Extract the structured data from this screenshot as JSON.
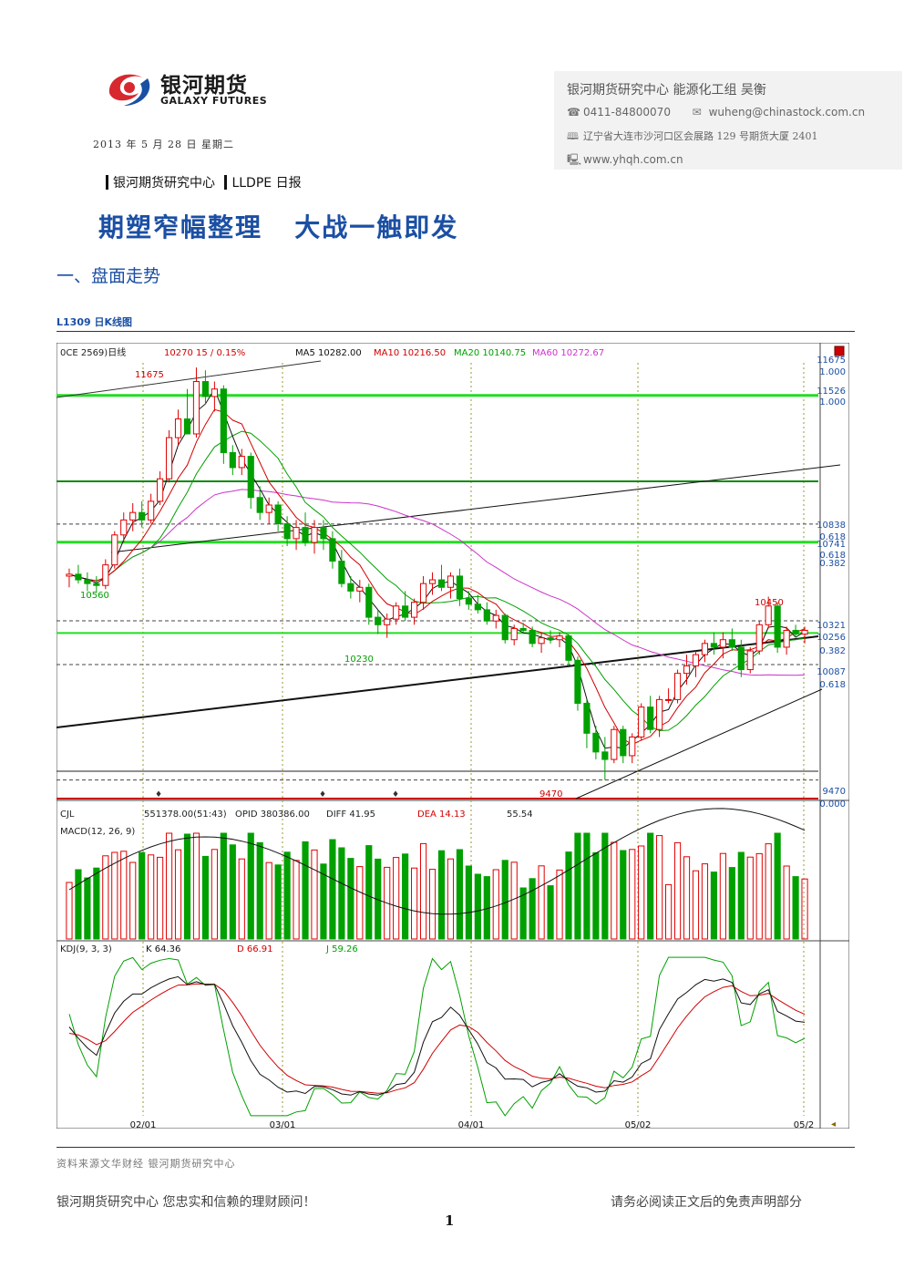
{
  "header": {
    "logo_cn": "银河期货",
    "logo_en": "GALAXY FUTURES",
    "date": "2013 年 5 月 28 日   星期二"
  },
  "contact": {
    "org": "银河期货研究中心    能源化工组 吴衡",
    "phone_icon": "☎",
    "phone": "0411-84800070",
    "mail_icon": "✉",
    "email": "wuheng@chinastock.com.cn",
    "addr_icon": "🕮",
    "address": "辽宁省大连市沙河口区会展路 129 号期货大厦 2401",
    "web_icon": "🖳",
    "website": "www.yhqh.com.cn"
  },
  "breadcrumb": {
    "part1": "银河期货研究中心",
    "part2": "LLDPE 日报"
  },
  "title": "期塑窄幅整理   大战一触即发",
  "section1": "一、盘面走势",
  "chart_caption": "L1309 日K线图",
  "chart_data": [
    {
      "type": "candlestick",
      "title": "L1309 日K线",
      "legend": {
        "code": "0CE 2569)日线",
        "price": "10270  15 / 0.15%",
        "ma5": "MA5 10282.00",
        "ma10": "MA10 10216.50",
        "ma20": "MA20 10140.75",
        "ma60": "MA60 10272.67"
      },
      "right_axis_labels": [
        "11675",
        "1.000",
        "11526",
        "1.000",
        "10838",
        "0.618",
        "10741",
        "0.618",
        "0.382",
        "10321",
        "10256",
        "0.382",
        "10087",
        "0.618",
        "9470",
        "0.000"
      ],
      "annotations": [
        "11675",
        "10560",
        "10230",
        "10450",
        "9470"
      ],
      "x_labels": [
        "02/01",
        "03/01",
        "04/01",
        "05/02",
        "05/2"
      ],
      "ylim": [
        9400,
        11700
      ],
      "horizontal_levels": [
        11526,
        10838,
        10741,
        10321,
        10256,
        10087,
        9470
      ],
      "candles": [
        [
          10560,
          10600,
          10500,
          10570
        ],
        [
          10570,
          10620,
          10520,
          10540
        ],
        [
          10540,
          10580,
          10480,
          10520
        ],
        [
          10520,
          10560,
          10470,
          10510
        ],
        [
          10510,
          10650,
          10490,
          10620
        ],
        [
          10620,
          10800,
          10600,
          10780
        ],
        [
          10780,
          10900,
          10740,
          10860
        ],
        [
          10860,
          10950,
          10800,
          10900
        ],
        [
          10900,
          10960,
          10820,
          10860
        ],
        [
          10860,
          11000,
          10840,
          10960
        ],
        [
          10960,
          11120,
          10940,
          11080
        ],
        [
          11080,
          11340,
          11060,
          11300
        ],
        [
          11300,
          11450,
          11260,
          11400
        ],
        [
          11400,
          11560,
          11360,
          11320
        ],
        [
          11320,
          11675,
          11300,
          11600
        ],
        [
          11600,
          11660,
          11480,
          11520
        ],
        [
          11520,
          11600,
          11440,
          11560
        ],
        [
          11560,
          11580,
          11160,
          11220
        ],
        [
          11220,
          11260,
          11100,
          11140
        ],
        [
          11140,
          11240,
          11100,
          11200
        ],
        [
          11200,
          11220,
          10920,
          10980
        ],
        [
          10980,
          11040,
          10860,
          10900
        ],
        [
          10900,
          10980,
          10840,
          10940
        ],
        [
          10940,
          10960,
          10800,
          10840
        ],
        [
          10840,
          10880,
          10720,
          10760
        ],
        [
          10760,
          10860,
          10700,
          10820
        ],
        [
          10820,
          10900,
          10720,
          10740
        ],
        [
          10740,
          10860,
          10680,
          10820
        ],
        [
          10820,
          10860,
          10700,
          10760
        ],
        [
          10760,
          10800,
          10600,
          10640
        ],
        [
          10640,
          10700,
          10500,
          10520
        ],
        [
          10520,
          10560,
          10440,
          10480
        ],
        [
          10480,
          10540,
          10420,
          10500
        ],
        [
          10500,
          10520,
          10300,
          10340
        ],
        [
          10340,
          10380,
          10250,
          10300
        ],
        [
          10300,
          10360,
          10230,
          10330
        ],
        [
          10330,
          10420,
          10300,
          10400
        ],
        [
          10400,
          10480,
          10320,
          10340
        ],
        [
          10340,
          10440,
          10300,
          10420
        ],
        [
          10420,
          10560,
          10380,
          10520
        ],
        [
          10520,
          10580,
          10460,
          10540
        ],
        [
          10540,
          10620,
          10480,
          10500
        ],
        [
          10500,
          10580,
          10440,
          10560
        ],
        [
          10560,
          10600,
          10400,
          10440
        ],
        [
          10440,
          10480,
          10380,
          10410
        ],
        [
          10410,
          10460,
          10360,
          10380
        ],
        [
          10380,
          10420,
          10300,
          10320
        ],
        [
          10320,
          10380,
          10280,
          10350
        ],
        [
          10350,
          10360,
          10200,
          10220
        ],
        [
          10220,
          10300,
          10190,
          10280
        ],
        [
          10280,
          10310,
          10260,
          10270
        ],
        [
          10270,
          10290,
          10180,
          10200
        ],
        [
          10200,
          10260,
          10150,
          10230
        ],
        [
          10230,
          10270,
          10200,
          10220
        ],
        [
          10220,
          10260,
          10180,
          10240
        ],
        [
          10240,
          10250,
          10080,
          10110
        ],
        [
          10110,
          10130,
          9840,
          9880
        ],
        [
          9880,
          9900,
          9640,
          9720
        ],
        [
          9720,
          9760,
          9580,
          9620
        ],
        [
          9620,
          9700,
          9470,
          9580
        ],
        [
          9580,
          9760,
          9560,
          9740
        ],
        [
          9740,
          9760,
          9560,
          9600
        ],
        [
          9600,
          9720,
          9560,
          9700
        ],
        [
          9700,
          9880,
          9680,
          9860
        ],
        [
          9860,
          9920,
          9720,
          9740
        ],
        [
          9740,
          9920,
          9700,
          9900
        ],
        [
          9900,
          9960,
          9880,
          9900
        ],
        [
          9900,
          10060,
          9880,
          10040
        ],
        [
          10040,
          10140,
          9980,
          10080
        ],
        [
          10080,
          10160,
          10020,
          10140
        ],
        [
          10140,
          10220,
          10100,
          10200
        ],
        [
          10200,
          10260,
          10140,
          10180
        ],
        [
          10180,
          10260,
          10120,
          10220
        ],
        [
          10220,
          10280,
          10160,
          10180
        ],
        [
          10180,
          10220,
          10020,
          10060
        ],
        [
          10060,
          10180,
          10040,
          10160
        ],
        [
          10160,
          10320,
          10140,
          10300
        ],
        [
          10300,
          10450,
          10280,
          10400
        ],
        [
          10400,
          10420,
          10150,
          10180
        ],
        [
          10180,
          10290,
          10140,
          10270
        ],
        [
          10270,
          10300,
          10230,
          10250
        ],
        [
          10250,
          10290,
          10200,
          10270
        ]
      ],
      "cjl_label": "CJL",
      "cjl_values": "551378.00(51:43)",
      "opid": "OPID  380386.00",
      "macd_label": "MACD(12, 26, 9)",
      "diff": "DIFF  41.95",
      "dea": "DEA  14.13",
      "macd": "55.54",
      "kdj_label": "KDJ(9, 3, 3)",
      "kdj_k": "K  64.36",
      "kdj_d": "D  66.91",
      "kdj_j": "J  59.26"
    }
  ],
  "source": "资料来源文华财经  银河期货研究中心",
  "footer": {
    "left": "银河期货研究中心  您忠实和信赖的理财顾问！",
    "right": "请务必阅读正文后的免责声明部分",
    "page": "1"
  },
  "colors": {
    "brand_blue": "#1b4fa3",
    "logo_red": "#d7282f",
    "up": "#e00000",
    "down": "#00a000"
  }
}
